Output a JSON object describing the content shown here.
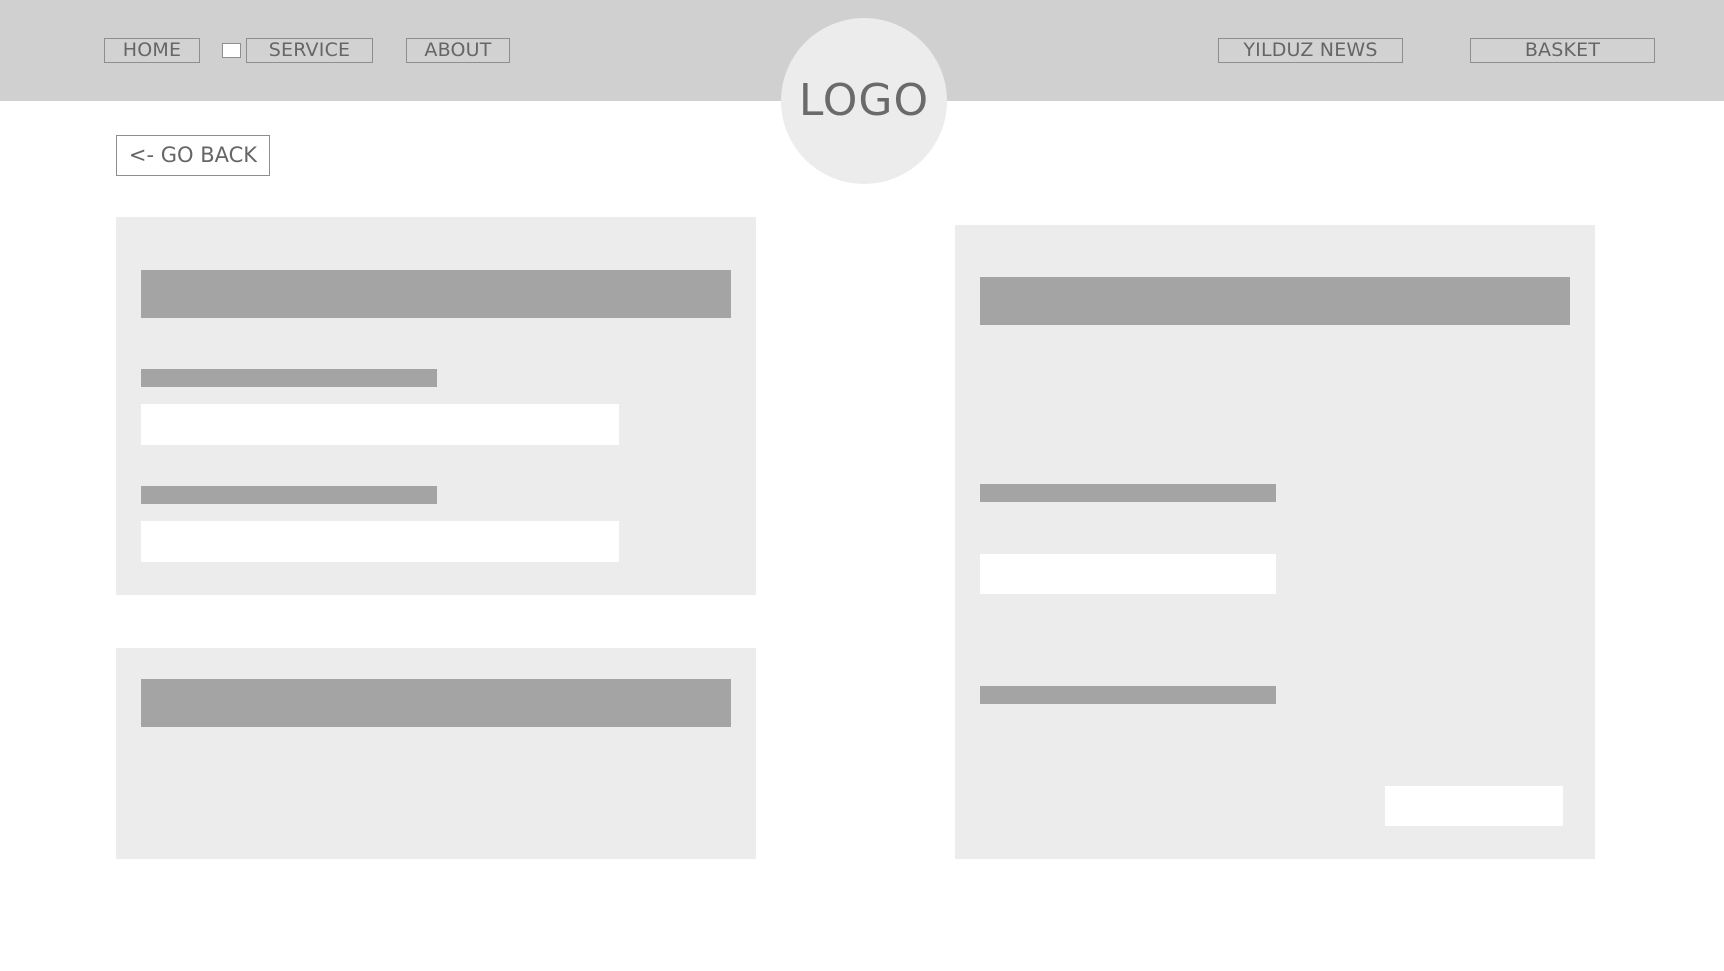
{
  "header": {
    "logo_text": "LOGO",
    "nav_left": [
      {
        "label": "HOME"
      },
      {
        "label": "SERVICE"
      },
      {
        "label": "ABOUT"
      }
    ],
    "nav_right": [
      {
        "label": "YILDUZ NEWS"
      },
      {
        "label": "BASKET"
      }
    ]
  },
  "main": {
    "go_back_label": "<- GO BACK"
  },
  "colors": {
    "header_bg": "#d0d0d0",
    "panel_bg": "#ececec",
    "placeholder_bar": "#a4a4a4",
    "field_bg": "#ffffff",
    "text": "#666666"
  }
}
